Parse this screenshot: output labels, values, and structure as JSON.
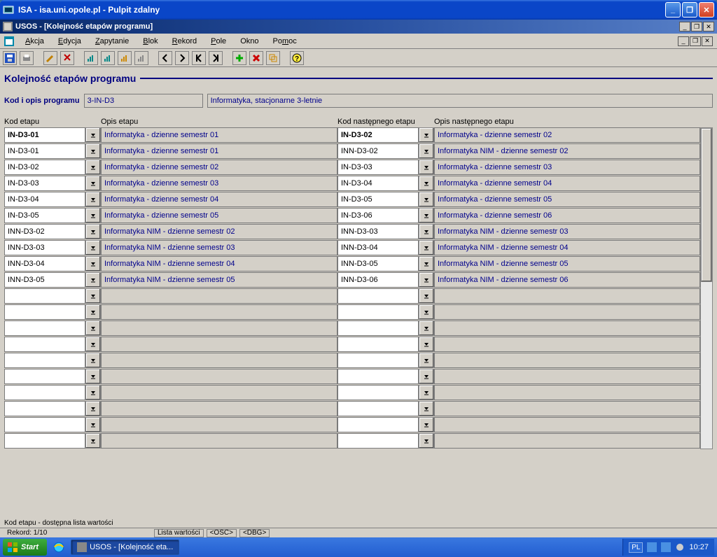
{
  "rdp": {
    "title": "ISA - isa.uni.opole.pl - Pulpit zdalny"
  },
  "mdi": {
    "title": "USOS - [Kolejność etapów programu]"
  },
  "menu": {
    "items": [
      "Akcja",
      "Edycja",
      "Zapytanie",
      "Blok",
      "Rekord",
      "Pole",
      "Okno",
      "Pomoc"
    ]
  },
  "page": {
    "title": "Kolejność etapów programu",
    "program_label": "Kod i opis programu",
    "program_code": "3-IN-D3",
    "program_desc": "Informatyka, stacjonarne 3-letnie"
  },
  "headers": {
    "kod": "Kod etapu",
    "opis": "Opis etapu",
    "kod_next": "Kod następnego etapu",
    "opis_next": "Opis następnego etapu"
  },
  "rows": [
    {
      "kod": "IN-D3-01",
      "opis": "Informatyka - dzienne semestr 01",
      "kod2": "IN-D3-02",
      "opis2": "Informatyka - dzienne semestr 02",
      "active": true
    },
    {
      "kod": "IN-D3-01",
      "opis": "Informatyka - dzienne semestr 01",
      "kod2": "INN-D3-02",
      "opis2": "Informatyka NIM - dzienne semestr 02"
    },
    {
      "kod": "IN-D3-02",
      "opis": "Informatyka - dzienne semestr 02",
      "kod2": "IN-D3-03",
      "opis2": "Informatyka - dzienne semestr 03"
    },
    {
      "kod": "IN-D3-03",
      "opis": "Informatyka - dzienne semestr 03",
      "kod2": "IN-D3-04",
      "opis2": "Informatyka - dzienne semestr 04"
    },
    {
      "kod": "IN-D3-04",
      "opis": "Informatyka - dzienne semestr 04",
      "kod2": "IN-D3-05",
      "opis2": "Informatyka - dzienne semestr 05"
    },
    {
      "kod": "IN-D3-05",
      "opis": "Informatyka - dzienne semestr 05",
      "kod2": "IN-D3-06",
      "opis2": "Informatyka - dzienne semestr 06"
    },
    {
      "kod": "INN-D3-02",
      "opis": "Informatyka NIM - dzienne semestr 02",
      "kod2": "INN-D3-03",
      "opis2": "Informatyka NIM - dzienne semestr 03"
    },
    {
      "kod": "INN-D3-03",
      "opis": "Informatyka NIM - dzienne semestr 03",
      "kod2": "INN-D3-04",
      "opis2": "Informatyka NIM - dzienne semestr 04"
    },
    {
      "kod": "INN-D3-04",
      "opis": "Informatyka NIM - dzienne semestr 04",
      "kod2": "INN-D3-05",
      "opis2": "Informatyka NIM - dzienne semestr 05"
    },
    {
      "kod": "INN-D3-05",
      "opis": "Informatyka NIM - dzienne semestr 05",
      "kod2": "INN-D3-06",
      "opis2": "Informatyka NIM - dzienne semestr 06"
    },
    {
      "kod": "",
      "opis": "",
      "kod2": "",
      "opis2": ""
    },
    {
      "kod": "",
      "opis": "",
      "kod2": "",
      "opis2": ""
    },
    {
      "kod": "",
      "opis": "",
      "kod2": "",
      "opis2": ""
    },
    {
      "kod": "",
      "opis": "",
      "kod2": "",
      "opis2": ""
    },
    {
      "kod": "",
      "opis": "",
      "kod2": "",
      "opis2": ""
    },
    {
      "kod": "",
      "opis": "",
      "kod2": "",
      "opis2": ""
    },
    {
      "kod": "",
      "opis": "",
      "kod2": "",
      "opis2": ""
    },
    {
      "kod": "",
      "opis": "",
      "kod2": "",
      "opis2": ""
    },
    {
      "kod": "",
      "opis": "",
      "kod2": "",
      "opis2": ""
    },
    {
      "kod": "",
      "opis": "",
      "kod2": "",
      "opis2": ""
    }
  ],
  "hint": "Kod etapu - dostępna lista wartości",
  "status": {
    "rekord": "Rekord: 1/10",
    "lw": "Lista wartości",
    "osc": "<OSC>",
    "dbg": "<DBG>"
  },
  "taskbar": {
    "start": "Start",
    "task": "USOS - [Kolejność eta...",
    "lang": "PL",
    "clock": "10:27"
  }
}
